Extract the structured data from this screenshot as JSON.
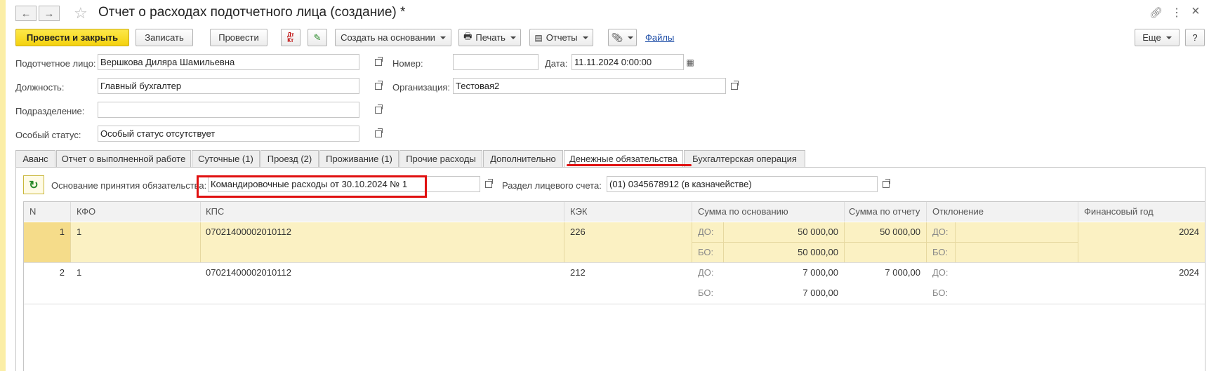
{
  "window": {
    "title": "Отчет о расходах подотчетного лица (создание) *",
    "more_label": "⋮",
    "close_label": "×"
  },
  "toolbar": {
    "post_close": "Провести и закрыть",
    "save": "Записать",
    "post": "Провести",
    "create_based": "Создать на основании",
    "print": "Печать",
    "reports": "Отчеты",
    "files": "Файлы",
    "more": "Еще",
    "help": "?"
  },
  "header": {
    "person_label": "Подотчетное лицо:",
    "person_value": "Вершкова Диляра Шамильевна",
    "number_label": "Номер:",
    "number_value": "",
    "date_label": "Дата:",
    "date_value": "11.11.2024  0:00:00",
    "position_label": "Должность:",
    "position_value": "Главный бухгалтер",
    "org_label": "Организация:",
    "org_value": "Тестовая2",
    "dept_label": "Подразделение:",
    "dept_value": "",
    "status_label": "Особый статус:",
    "status_value": "Особый статус отсутствует"
  },
  "tabs": [
    {
      "label": "Аванс"
    },
    {
      "label": "Отчет о выполненной работе"
    },
    {
      "label": "Суточные (1)"
    },
    {
      "label": "Проезд (2)"
    },
    {
      "label": "Проживание (1)"
    },
    {
      "label": "Прочие расходы"
    },
    {
      "label": "Дополнительно"
    },
    {
      "label": "Денежные обязательства"
    },
    {
      "label": "Бухгалтерская операция"
    }
  ],
  "obligations": {
    "basis_label": "Основание принятия обязательства:",
    "basis_value": "Командировочные расходы от 30.10.2024 № 1",
    "account_label": "Раздел лицевого счета:",
    "account_value": "(01) 0345678912 (в казначействе)"
  },
  "table": {
    "columns": [
      "N",
      "КФО",
      "КПС",
      "КЭК",
      "Сумма по основанию",
      "Сумма по отчету",
      "Отклонение",
      "Финансовый год"
    ],
    "rows": [
      {
        "n": "1",
        "kfo": "1",
        "kps": "07021400002010112",
        "kek": "226",
        "do_label": "ДО:",
        "do_value": "50 000,00",
        "bo_label": "БО:",
        "bo_value": "50 000,00",
        "report": "50 000,00",
        "dev_do": "ДО:",
        "dev_bo": "БО:",
        "year": "2024"
      },
      {
        "n": "2",
        "kfo": "1",
        "kps": "07021400002010112",
        "kek": "212",
        "do_label": "ДО:",
        "do_value": "7 000,00",
        "bo_label": "БО:",
        "bo_value": "7 000,00",
        "report": "7 000,00",
        "dev_do": "ДО:",
        "dev_bo": "БО:",
        "year": "2024"
      }
    ]
  },
  "colors": {
    "accent_yellow": "#f4d20e",
    "selected_row": "#fbf1c3",
    "annotation_red": "#e01010",
    "link_blue": "#1f4fa8"
  }
}
